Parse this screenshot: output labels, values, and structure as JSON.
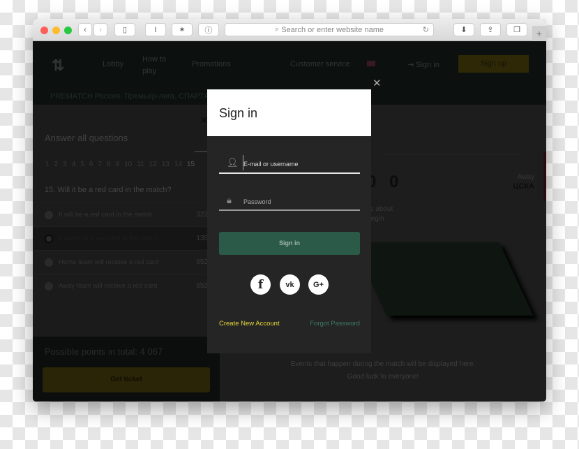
{
  "browser": {
    "url_placeholder": "Search or enter website name",
    "reader": "I",
    "new_tab": "+"
  },
  "header": {
    "nav": [
      "Lobby",
      "How to play",
      "Promotions",
      "Customer service"
    ],
    "sign_in": "Sign in",
    "sign_up": "Sign up",
    "breadcrumb": "PREMATCH Россия. Премьер-лига. СПАРТАК М"
  },
  "quiz": {
    "title": "Answer all questions",
    "numbers": [
      "1",
      "2",
      "3",
      "4",
      "5",
      "6",
      "7",
      "8",
      "9",
      "10",
      "11",
      "12",
      "13",
      "14",
      "15"
    ],
    "question": "15. Will it be a red card in the match?",
    "options": [
      {
        "label": "It will be a red card in the match",
        "points": "322"
      },
      {
        "label": "It won't be a red card in the match",
        "points": "135"
      },
      {
        "label": "Home team will receive a red card",
        "points": "652"
      },
      {
        "label": "Away team will receive a red card",
        "points": "652"
      }
    ],
    "total": "Possible points in total: 4 067",
    "get_ticket": "Get ticket"
  },
  "match": {
    "score_a": "0",
    "score_b": "0",
    "away_label": "Away",
    "away_team": "ЦСКА",
    "status": "ch is about\nto begin",
    "events_line1": "Events that happen during the match will be displayed here.",
    "events_line2": "Good luck to everyone!"
  },
  "modal": {
    "title": "Sign in",
    "email_placeholder": "E-mail or username",
    "password_placeholder": "Password",
    "submit": "Sign in",
    "create_account": "Create New Account",
    "forgot_password": "Forgot Password",
    "close": "✕",
    "social": [
      "f",
      "vk",
      "G+"
    ]
  },
  "colors": {
    "accent_green": "#2c5a48",
    "link_yellow": "#e8d83a",
    "link_green": "#3d7a62",
    "signup_yellow": "#2e2806"
  }
}
